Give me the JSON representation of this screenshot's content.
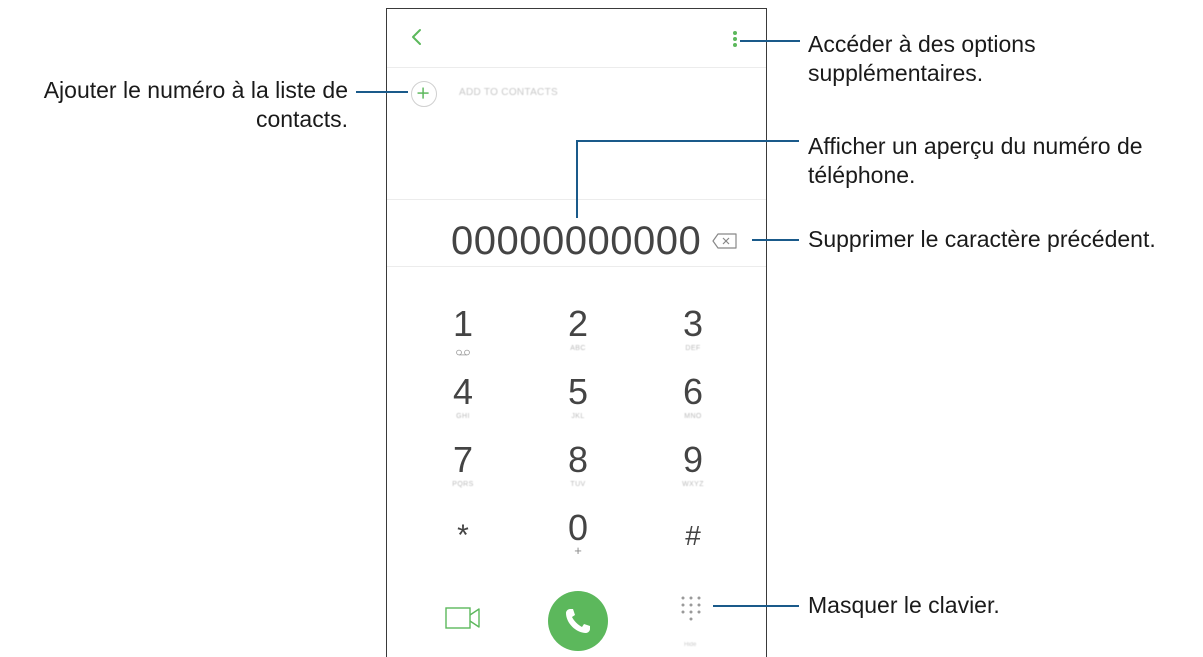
{
  "callouts": {
    "add_contact": "Ajouter le numéro à la liste de contacts.",
    "more_options": "Accéder à des options supplémentaires.",
    "preview": "Afficher un aperçu du numéro de téléphone.",
    "delete_char": "Supprimer le caractère précédent.",
    "hide_keypad": "Masquer le clavier."
  },
  "phone": {
    "add_to_contacts": "ADD TO CONTACTS",
    "number": "00000000000",
    "keypad_label": "Hide",
    "keys": [
      {
        "digit": "1",
        "letters": ""
      },
      {
        "digit": "2",
        "letters": "ABC"
      },
      {
        "digit": "3",
        "letters": "DEF"
      },
      {
        "digit": "4",
        "letters": "GHI"
      },
      {
        "digit": "5",
        "letters": "JKL"
      },
      {
        "digit": "6",
        "letters": "MNO"
      },
      {
        "digit": "7",
        "letters": "PQRS"
      },
      {
        "digit": "8",
        "letters": "TUV"
      },
      {
        "digit": "9",
        "letters": "WXYZ"
      },
      {
        "digit": "*",
        "letters": ""
      },
      {
        "digit": "0",
        "letters": "+"
      },
      {
        "digit": "#",
        "letters": ""
      }
    ]
  },
  "colors": {
    "accent_green": "#5cb85c",
    "callout_line": "#1a5a8a"
  },
  "icons": [
    "back-arrow-icon",
    "more-options-icon",
    "add-icon",
    "backspace-icon",
    "voicemail-icon",
    "video-call-icon",
    "phone-icon",
    "keypad-icon"
  ]
}
